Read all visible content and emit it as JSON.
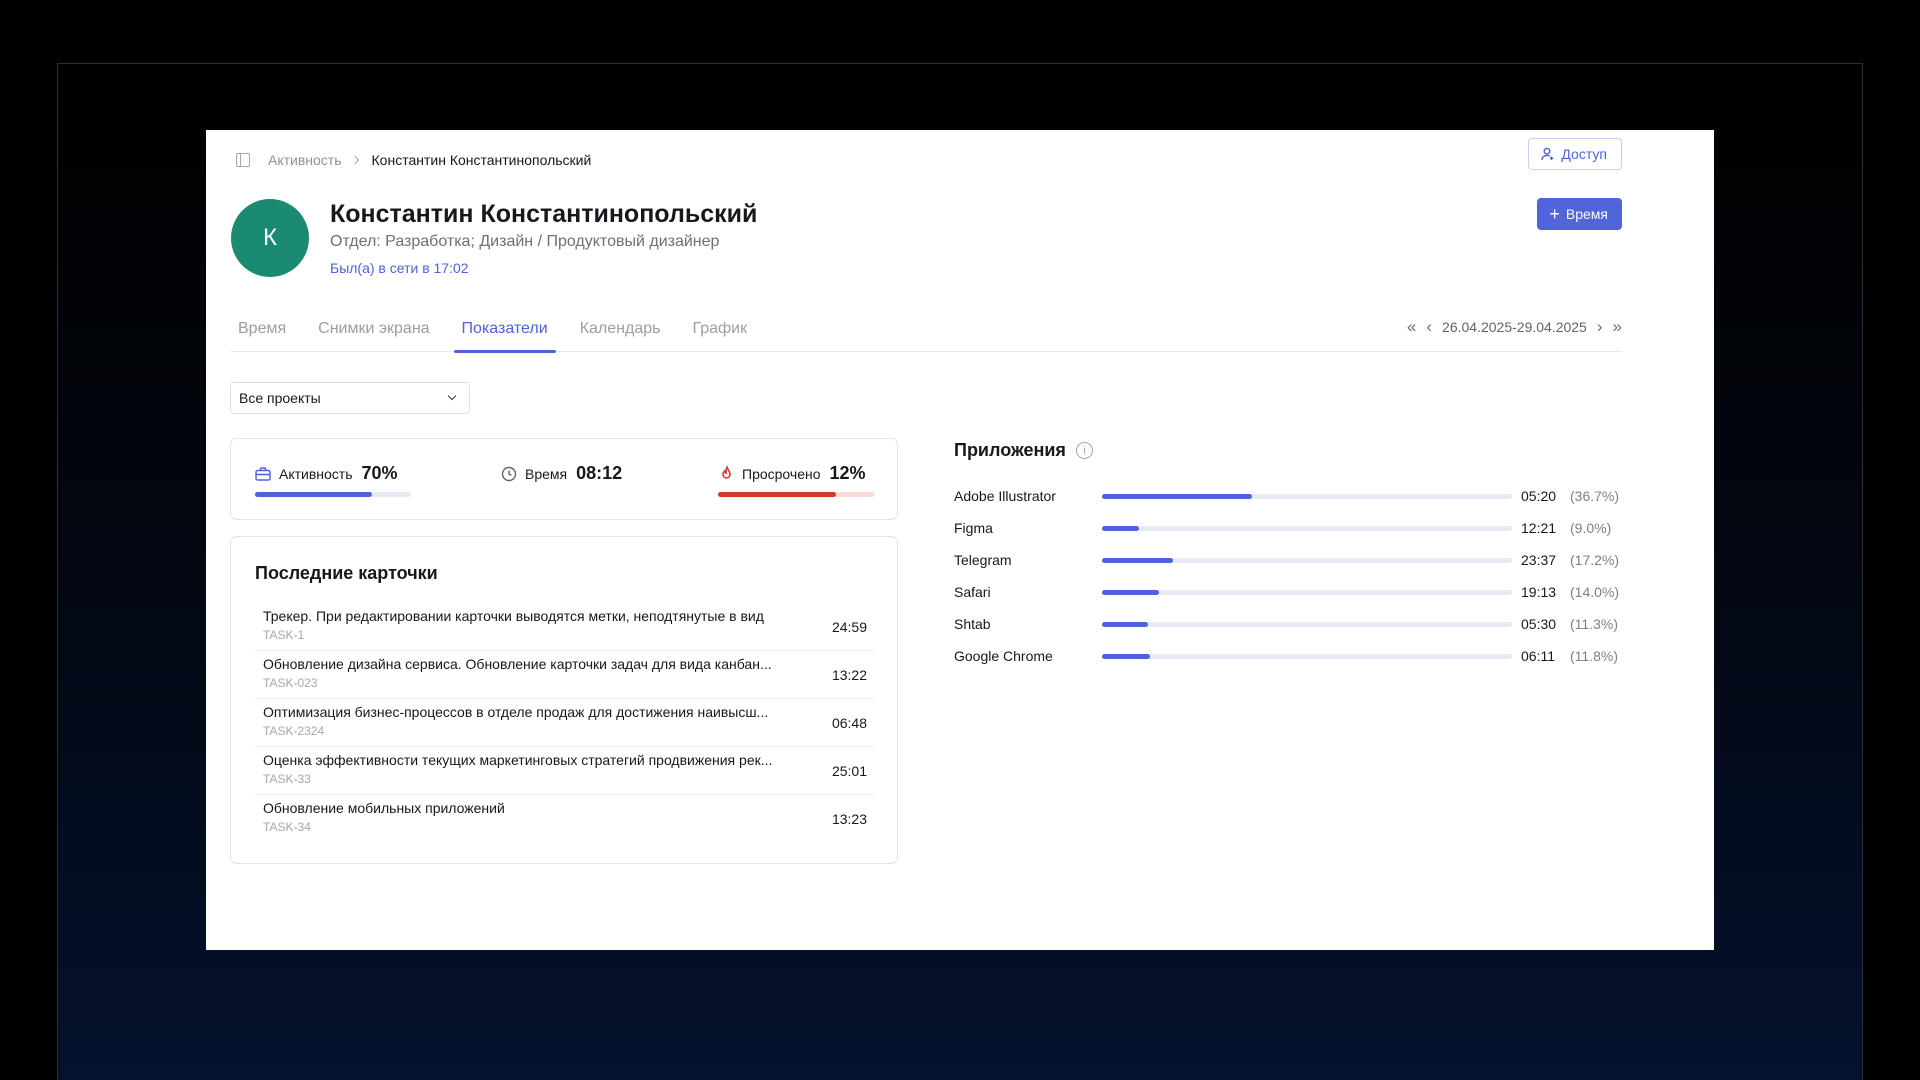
{
  "breadcrumb": {
    "parent": "Активность",
    "current": "Константин Константинопольский"
  },
  "header": {
    "access_label": "Доступ",
    "add_time_label": "Время"
  },
  "profile": {
    "initial": "К",
    "name": "Константин Константинопольский",
    "department": "Отдел: Разработка; Дизайн / Продуктовый дизайнер",
    "last_seen": "Был(а) в сети в 17:02"
  },
  "tabs": [
    {
      "label": "Время",
      "active": false
    },
    {
      "label": "Снимки экрана",
      "active": false
    },
    {
      "label": "Показатели",
      "active": true
    },
    {
      "label": "Календарь",
      "active": false
    },
    {
      "label": "График",
      "active": false
    }
  ],
  "date_range": "26.04.2025-29.04.2025",
  "project_filter": {
    "selected": "Все проекты"
  },
  "stats": {
    "activity": {
      "label": "Активность",
      "value": "70%",
      "level": 0.75
    },
    "time": {
      "label": "Время",
      "value": "08:12"
    },
    "overdue": {
      "label": "Просрочено",
      "value": "12%",
      "level": 0.75
    }
  },
  "cards": {
    "title": "Последние карточки",
    "items": [
      {
        "title": "Трекер. При редактировании карточки выводятся метки, неподтянутые в вид",
        "id": "TASK-1",
        "time": "24:59"
      },
      {
        "title": "Обновление дизайна сервиса. Обновление карточки задач для вида канбан...",
        "id": "TASK-023",
        "time": "13:22"
      },
      {
        "title": "Оптимизация бизнес-процессов в отделе продаж для достижения наивысш...",
        "id": "TASK-2324",
        "time": "06:48"
      },
      {
        "title": "Оценка эффективности текущих маркетинговых стратегий продвижения рек...",
        "id": "TASK-33",
        "time": "25:01"
      },
      {
        "title": "Обновление мобильных приложений",
        "id": "TASK-34",
        "time": "13:23"
      }
    ]
  },
  "apps": {
    "title": "Приложения",
    "items": [
      {
        "name": "Adobe Illustrator",
        "time": "05:20",
        "percent": "(36.7%)",
        "level": 0.367
      },
      {
        "name": "Figma",
        "time": "12:21",
        "percent": "(9.0%)",
        "level": 0.09
      },
      {
        "name": "Telegram",
        "time": "23:37",
        "percent": "(17.2%)",
        "level": 0.172
      },
      {
        "name": "Safari",
        "time": "19:13",
        "percent": "(14.0%)",
        "level": 0.14
      },
      {
        "name": "Shtab",
        "time": "05:30",
        "percent": "(11.3%)",
        "level": 0.113
      },
      {
        "name": "Google Chrome",
        "time": "06:11",
        "percent": "(11.8%)",
        "level": 0.118
      }
    ]
  },
  "colors": {
    "accent": "#4e62d9",
    "avatar": "#1a8a73",
    "overdue": "#d4372b"
  }
}
